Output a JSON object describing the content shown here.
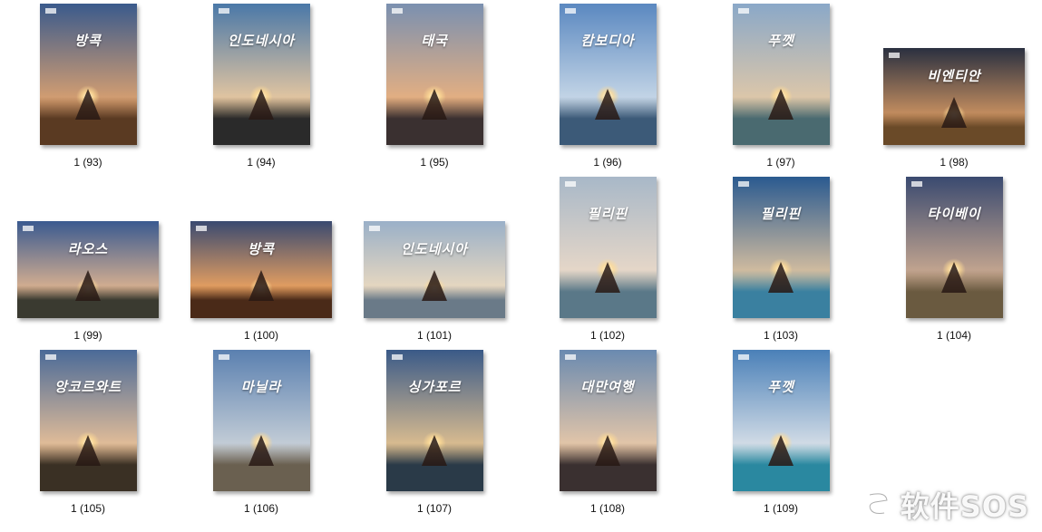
{
  "files": [
    {
      "name": "1 (93)",
      "orient": "portrait",
      "text": "방콕",
      "sky": [
        "#3a5a8c",
        "#d9a070"
      ],
      "ground": "#5a3a22"
    },
    {
      "name": "1 (94)",
      "orient": "portrait",
      "text": "인도네시아",
      "sky": [
        "#4a78a8",
        "#e8c8a0"
      ],
      "ground": "#2a2a2a"
    },
    {
      "name": "1 (95)",
      "orient": "portrait",
      "text": "태국",
      "sky": [
        "#7a90b0",
        "#e8b080"
      ],
      "ground": "#3a3030"
    },
    {
      "name": "1 (96)",
      "orient": "portrait",
      "text": "캄보디아",
      "sky": [
        "#5a88c0",
        "#c8d8e8"
      ],
      "ground": "#3c5a78"
    },
    {
      "name": "1 (97)",
      "orient": "portrait",
      "text": "푸껫",
      "sky": [
        "#8aa8c8",
        "#e0c8a8"
      ],
      "ground": "#4a6a70"
    },
    {
      "name": "1 (98)",
      "orient": "landscape",
      "text": "비엔티안",
      "sky": [
        "#2a3040",
        "#c89060"
      ],
      "ground": "#6a4a28"
    },
    {
      "name": "1 (99)",
      "orient": "landscape",
      "text": "라오스",
      "sky": [
        "#3a5a90",
        "#d8b090"
      ],
      "ground": "#3a3a30"
    },
    {
      "name": "1 (100)",
      "orient": "landscape",
      "text": "방콕",
      "sky": [
        "#3a4a70",
        "#e8a060"
      ],
      "ground": "#4a2a18"
    },
    {
      "name": "1 (101)",
      "orient": "landscape",
      "text": "인도네시아",
      "sky": [
        "#9ab0c8",
        "#e8d8c0"
      ],
      "ground": "#6a7a88"
    },
    {
      "name": "1 (102)",
      "orient": "portrait",
      "text": "필리핀",
      "sky": [
        "#a8b8c8",
        "#e8d8c8"
      ],
      "ground": "#5a7888"
    },
    {
      "name": "1 (103)",
      "orient": "portrait",
      "text": "필리핀",
      "sky": [
        "#2a5a90",
        "#d8c0a0"
      ],
      "ground": "#3a80a0"
    },
    {
      "name": "1 (104)",
      "orient": "portrait",
      "text": "타이베이",
      "sky": [
        "#3a4a70",
        "#c8a890"
      ],
      "ground": "#6a5a40"
    },
    {
      "name": "1 (105)",
      "orient": "portrait",
      "text": "앙코르와트",
      "sky": [
        "#4a6a98",
        "#e8c098"
      ],
      "ground": "#3a3024"
    },
    {
      "name": "1 (106)",
      "orient": "portrait",
      "text": "마닐라",
      "sky": [
        "#5a80b0",
        "#c8d0d8"
      ],
      "ground": "#6a6050"
    },
    {
      "name": "1 (107)",
      "orient": "portrait",
      "text": "싱가포르",
      "sky": [
        "#3a5a88",
        "#e0c090"
      ],
      "ground": "#2a3a48"
    },
    {
      "name": "1 (108)",
      "orient": "portrait",
      "text": "대만여행",
      "sky": [
        "#6a8ab0",
        "#e8c8a8"
      ],
      "ground": "#3a3030"
    },
    {
      "name": "1 (109)",
      "orient": "portrait",
      "text": "푸껫",
      "sky": [
        "#4a80b8",
        "#d8e0e8"
      ],
      "ground": "#2a88a0"
    }
  ],
  "watermark": {
    "text": "软件SOS"
  }
}
